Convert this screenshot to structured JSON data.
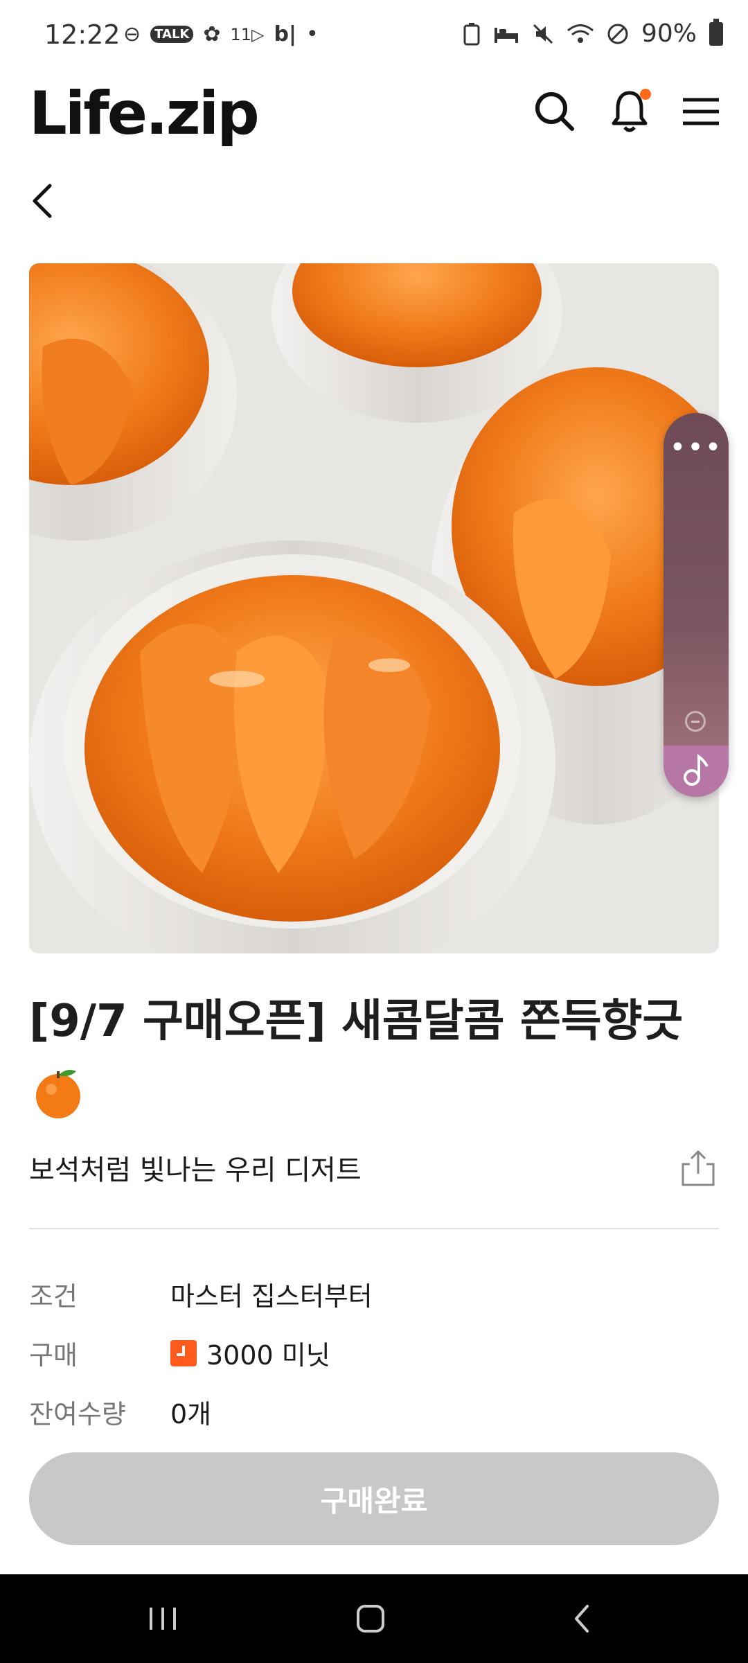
{
  "status_bar": {
    "time": "12:22",
    "left_icons": [
      "dnd-icon",
      "talk-icon",
      "flower-icon",
      "11st-icon",
      "b-icon",
      "dot-icon"
    ],
    "left_text": [
      "⊖",
      "TALK",
      "✿",
      "11▷",
      "b|",
      "•"
    ],
    "battery": "90%"
  },
  "header": {
    "logo": "Life.zip",
    "notification_dot_color": "#ff6b1a"
  },
  "product": {
    "title": "[9/7 구매오픈] 새콤달콤 쫀득향긋",
    "emoji": "orange",
    "subtitle": "보석처럼 빛나는 우리 디저트"
  },
  "info": {
    "rows": [
      {
        "label": "조건",
        "value": "마스터 집스터부터"
      },
      {
        "label": "구매",
        "value": "3000 미닛"
      },
      {
        "label": "잔여수량",
        "value": "0개"
      }
    ]
  },
  "buy_button": {
    "label": "구매완료",
    "state": "disabled",
    "color": "#c8c8c8"
  },
  "float_panel": {
    "dots": "•••"
  },
  "colors": {
    "accent": "#ff5a1e",
    "panel_gradient_start": "#6e4a57",
    "panel_gradient_end": "#b774a5"
  }
}
